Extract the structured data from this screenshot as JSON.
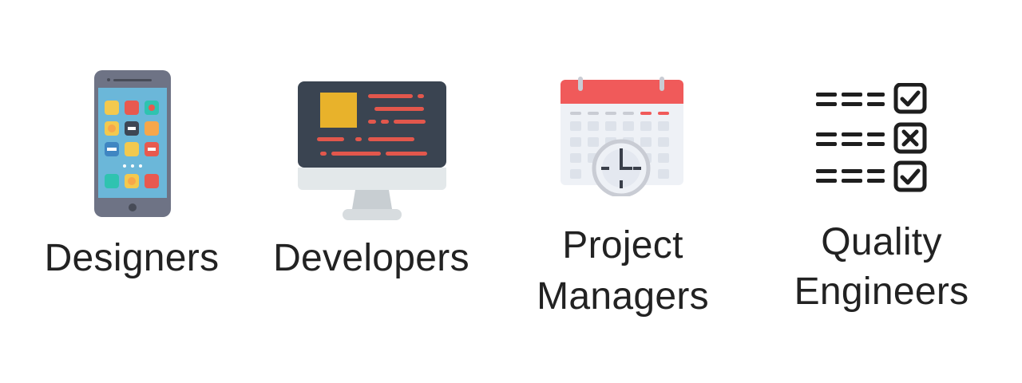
{
  "roles": [
    {
      "icon": "smartphone-icon",
      "label": "Designers"
    },
    {
      "icon": "desktop-monitor-icon",
      "label": "Developers"
    },
    {
      "icon": "calendar-clock-icon",
      "label_line1": "Project",
      "label_line2": "Managers"
    },
    {
      "icon": "checklist-icon",
      "label_line1": "Quality",
      "label_line2": "Engineers"
    }
  ],
  "colors": {
    "text": "#222222",
    "phone_body": "#6e7385",
    "phone_screen": "#6bb7d9",
    "monitor_frame": "#3a4451",
    "monitor_stand": "#d7dcdf",
    "accent_yellow": "#e8b22b",
    "accent_red": "#e2574c",
    "calendar_header": "#f05a5a",
    "checklist_ink": "#1e1e1e"
  }
}
